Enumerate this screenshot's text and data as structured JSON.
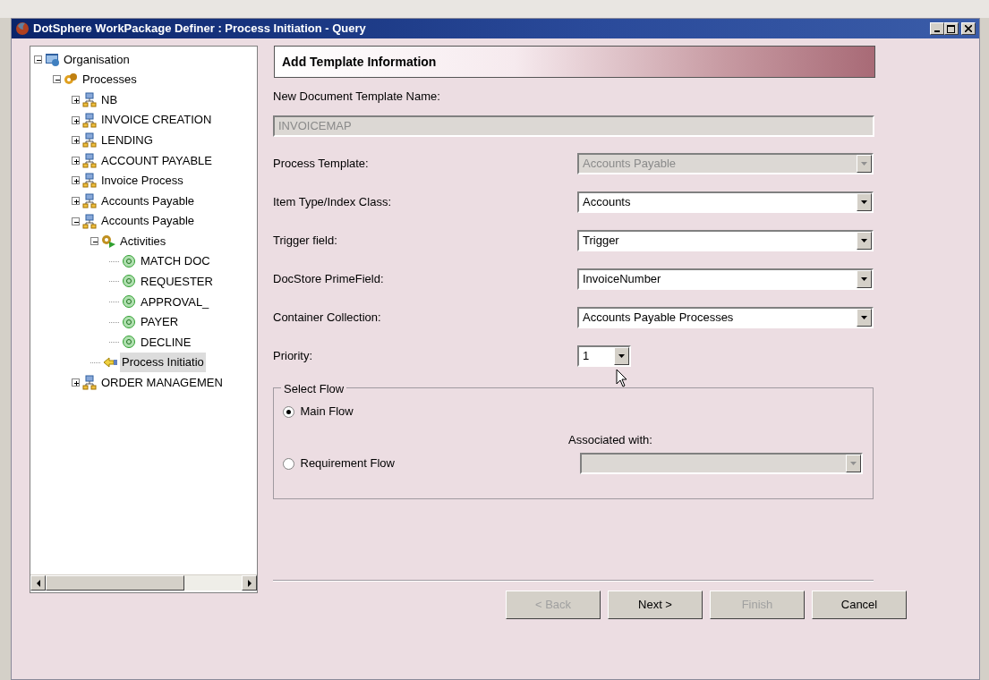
{
  "window": {
    "title": "DotSphere WorkPackage Definer : Process Initiation - Query"
  },
  "tree": {
    "items": [
      {
        "label": "Organisation",
        "kind": "organisation",
        "expanded": true,
        "selected": false,
        "children": [
          {
            "label": "Processes",
            "kind": "processes",
            "expanded": true,
            "selected": false,
            "children": [
              {
                "label": "NB",
                "kind": "process",
                "expanded": false,
                "selected": false
              },
              {
                "label": "INVOICE CREATION",
                "kind": "process",
                "expanded": false,
                "selected": false
              },
              {
                "label": "LENDING",
                "kind": "process",
                "expanded": false,
                "selected": false
              },
              {
                "label": "ACCOUNT PAYABLE",
                "kind": "process",
                "expanded": false,
                "selected": false
              },
              {
                "label": "Invoice Process",
                "kind": "process",
                "expanded": false,
                "selected": false
              },
              {
                "label": "Accounts  Payable",
                "kind": "process",
                "expanded": false,
                "selected": false
              },
              {
                "label": "Accounts Payable",
                "kind": "process",
                "expanded": true,
                "selected": false,
                "children": [
                  {
                    "label": "Activities",
                    "kind": "activities",
                    "expanded": true,
                    "selected": false,
                    "children": [
                      {
                        "label": "MATCH DOC",
                        "kind": "activity",
                        "selected": false
                      },
                      {
                        "label": "REQUESTER",
                        "kind": "activity",
                        "selected": false
                      },
                      {
                        "label": "APPROVAL_",
                        "kind": "activity",
                        "selected": false
                      },
                      {
                        "label": "PAYER",
                        "kind": "activity",
                        "selected": false
                      },
                      {
                        "label": "DECLINE",
                        "kind": "activity",
                        "selected": false
                      }
                    ]
                  },
                  {
                    "label": "Process Initiatio",
                    "kind": "initiation",
                    "selected": true
                  }
                ]
              },
              {
                "label": "ORDER MANAGEMEN",
                "kind": "process",
                "expanded": false,
                "selected": false
              }
            ]
          }
        ]
      }
    ]
  },
  "form": {
    "heading": "Add Template Information",
    "fields": [
      {
        "label": "New Document Template Name:",
        "kind": "text",
        "value": "INVOICEMAP",
        "disabled": true
      },
      {
        "label": "Process Template:",
        "kind": "combo",
        "value": "Accounts Payable",
        "disabled": true
      },
      {
        "label": "Item Type/Index Class:",
        "kind": "combo",
        "value": "Accounts",
        "disabled": false
      },
      {
        "label": "Trigger field:",
        "kind": "combo",
        "value": "Trigger",
        "disabled": false
      },
      {
        "label": "DocStore PrimeField:",
        "kind": "combo",
        "value": "InvoiceNumber",
        "disabled": false
      },
      {
        "label": "Container Collection:",
        "kind": "combo",
        "value": "Accounts Payable Processes",
        "disabled": false
      },
      {
        "label": "Priority:",
        "kind": "short-combo",
        "value": "1",
        "disabled": false
      }
    ],
    "flow": {
      "legend": "Select Flow",
      "options": [
        {
          "label": "Main Flow",
          "selected": true
        },
        {
          "label": "Requirement Flow",
          "selected": false
        }
      ],
      "associated_label": "Associated with:",
      "associated_combo": {
        "disabled": true
      }
    }
  },
  "buttons": [
    {
      "label": "< Back",
      "disabled": true
    },
    {
      "label": "Next >",
      "disabled": false
    },
    {
      "label": "Finish",
      "disabled": true
    },
    {
      "label": "Cancel",
      "disabled": false
    }
  ]
}
